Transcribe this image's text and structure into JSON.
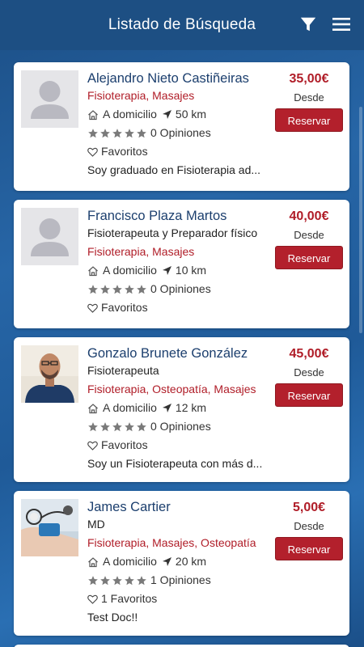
{
  "header": {
    "title": "Listado de Búsqueda"
  },
  "cards": [
    {
      "name": "Alejandro Nieto Castiñeiras",
      "subtitle": "",
      "specialties": "Fisioterapia, Masajes",
      "location": "A domicilio",
      "distance": "50 km",
      "rating": 5,
      "reviews": "0 Opiniones",
      "favorites": "Favoritos",
      "description": "Soy graduado en Fisioterapia ad...",
      "price": "35,00€",
      "desde": "Desde",
      "reserve": "Reservar",
      "avatar": "placeholder"
    },
    {
      "name": "Francisco Plaza Martos",
      "subtitle": "Fisioterapeuta y Preparador físico",
      "specialties": "Fisioterapia, Masajes",
      "location": "A domicilio",
      "distance": "10 km",
      "rating": 5,
      "reviews": "0 Opiniones",
      "favorites": "Favoritos",
      "description": "",
      "price": "40,00€",
      "desde": "Desde",
      "reserve": "Reservar",
      "avatar": "placeholder"
    },
    {
      "name": "Gonzalo Brunete González",
      "subtitle": "Fisioterapeuta",
      "specialties": "Fisioterapia, Osteopatía, Masajes",
      "location": "A domicilio",
      "distance": "12 km",
      "rating": 5,
      "reviews": "0 Opiniones",
      "favorites": "Favoritos",
      "description": "Soy un Fisioterapeuta con más d...",
      "price": "45,00€",
      "desde": "Desde",
      "reserve": "Reservar",
      "avatar": "photo-man"
    },
    {
      "name": "James Cartier",
      "subtitle": "MD",
      "specialties": "Fisioterapia, Masajes, Osteopatía",
      "location": "A domicilio",
      "distance": "20 km",
      "rating": 5,
      "reviews": "1 Opiniones",
      "favorites": "1 Favoritos",
      "description": "Test Doc!!",
      "price": "5,00€",
      "desde": "Desde",
      "reserve": "Reservar",
      "avatar": "photo-blood-pressure"
    }
  ],
  "colors": {
    "header_bg": "#1d4f83",
    "name": "#1c3f6e",
    "accent_red": "#b01d28",
    "star_gray": "#7a7a7a"
  }
}
